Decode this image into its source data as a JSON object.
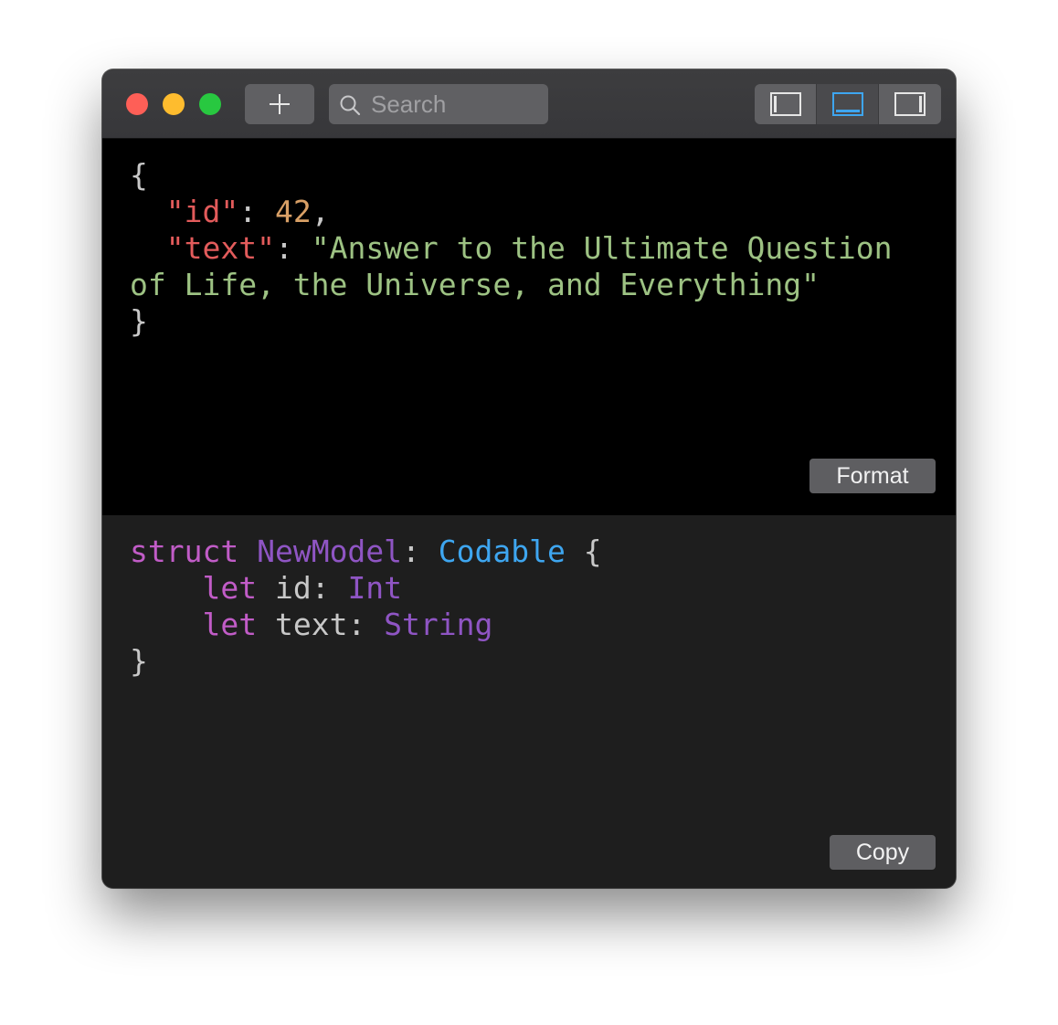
{
  "toolbar": {
    "add_icon": "plus-icon",
    "search": {
      "placeholder": "Search",
      "value": "",
      "icon": "magnifier-icon"
    },
    "layout_buttons": [
      {
        "icon": "sidebar-left-icon",
        "selected": false
      },
      {
        "icon": "panel-bottom-icon",
        "selected": true
      },
      {
        "icon": "sidebar-right-icon",
        "selected": false
      }
    ],
    "accent_color": "#3ea6f0"
  },
  "json_editor": {
    "lines": [
      [
        {
          "t": "punct",
          "v": "{"
        }
      ],
      [
        {
          "t": "punct",
          "v": "  "
        },
        {
          "t": "key",
          "v": "\"id\""
        },
        {
          "t": "punct",
          "v": ": "
        },
        {
          "t": "num",
          "v": "42"
        },
        {
          "t": "punct",
          "v": ","
        }
      ],
      [
        {
          "t": "punct",
          "v": "  "
        },
        {
          "t": "key",
          "v": "\"text\""
        },
        {
          "t": "punct",
          "v": ": "
        },
        {
          "t": "str",
          "v": "\"Answer to the Ultimate Question"
        }
      ],
      [
        {
          "t": "str",
          "v": "of Life, the Universe, and Everything\""
        }
      ],
      [
        {
          "t": "punct",
          "v": "}"
        }
      ]
    ],
    "button_label": "Format"
  },
  "model_output": {
    "lines": [
      [
        {
          "t": "kw",
          "v": "struct"
        },
        {
          "t": "ident",
          "v": " "
        },
        {
          "t": "type",
          "v": "NewModel"
        },
        {
          "t": "ident",
          "v": ": "
        },
        {
          "t": "proto",
          "v": "Codable"
        },
        {
          "t": "ident",
          "v": " {"
        }
      ],
      [
        {
          "t": "ident",
          "v": "    "
        },
        {
          "t": "kw",
          "v": "let"
        },
        {
          "t": "ident",
          "v": " id: "
        },
        {
          "t": "type",
          "v": "Int"
        }
      ],
      [
        {
          "t": "ident",
          "v": "    "
        },
        {
          "t": "kw",
          "v": "let"
        },
        {
          "t": "ident",
          "v": " text: "
        },
        {
          "t": "type",
          "v": "String"
        }
      ],
      [
        {
          "t": "ident",
          "v": "}"
        }
      ]
    ],
    "button_label": "Copy"
  }
}
